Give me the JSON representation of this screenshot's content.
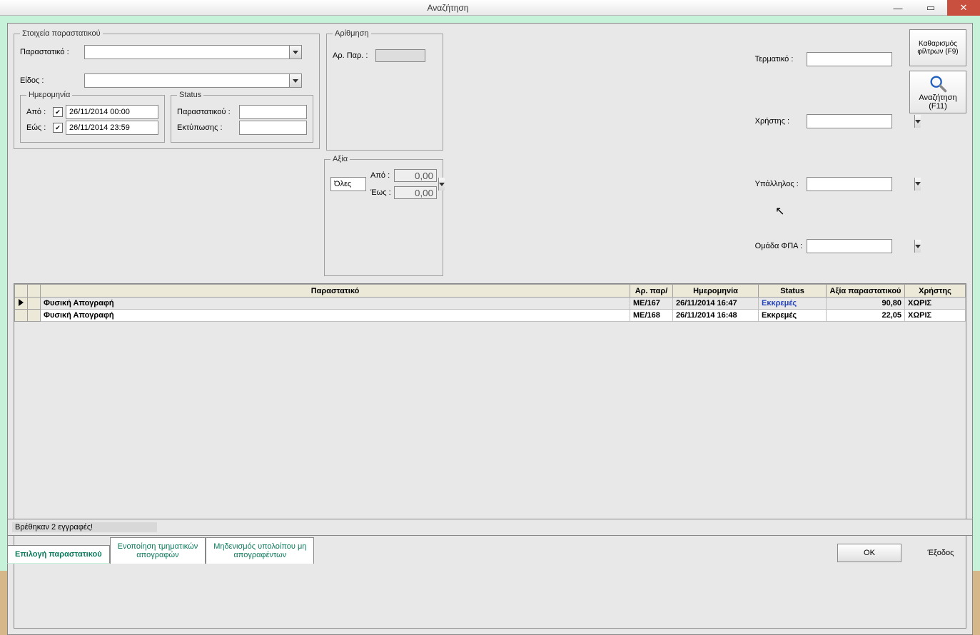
{
  "window": {
    "title": "Αναζήτηση"
  },
  "doc_group": {
    "legend": "Στοιχεία παραστατικού",
    "parastatiko_label": "Παραστατικό :",
    "eidos_label": "Είδος :"
  },
  "num_group": {
    "legend": "Αρίθμηση",
    "ar_par_label": "Αρ. Παρ. :"
  },
  "date_group": {
    "legend": "Ημερομηνία",
    "apo_label": "Από :",
    "eos_label": "Εώς :",
    "apo_val": "26/11/2014 00:00",
    "eos_val": "26/11/2014 23:59"
  },
  "status_group": {
    "legend": "Status",
    "par_label": "Παραστατικού :",
    "ekt_label": "Εκτύπωσης :"
  },
  "value_group": {
    "legend": "Αξία",
    "all_label": "Όλες",
    "apo_label": "Από :",
    "eos_label": "Έως :",
    "apo_val": "0,00",
    "eos_val": "0,00"
  },
  "right": {
    "term_label": "Τερματικό :",
    "user_label": "Χρήστης :",
    "emp_label": "Υπάλληλος :",
    "vat_label": "Ομάδα ΦΠΑ :"
  },
  "buttons": {
    "clear_l1": "Καθαρισμός",
    "clear_l2": "φίλτρων (F9)",
    "search_l1": "Αναζήτηση",
    "search_l2": "(F11)"
  },
  "table": {
    "headers": {
      "doc": "Παραστατικό",
      "num": "Αρ. παρ/",
      "date": "Ημερομηνία",
      "status": "Status",
      "value": "Αξία παραστατικού",
      "user": "Χρήστης"
    },
    "rows": [
      {
        "doc": "Φυσική Απογραφή",
        "num": "ΜΕ/167",
        "date": "26/11/2014 16:47",
        "status": "Εκκρεμές",
        "value": "90,80",
        "user": "ΧΩΡΙΣ"
      },
      {
        "doc": "Φυσική Απογραφή",
        "num": "ΜΕ/168",
        "date": "26/11/2014 16:48",
        "status": "Εκκρεμές",
        "value": "22,05",
        "user": "ΧΩΡΙΣ"
      }
    ]
  },
  "footer": {
    "status_msg": "Βρέθηκαν 2 εγγραφές!",
    "tab1": "Επιλογή παραστατικού",
    "tab2_l1": "Ενοποίηση τμηματικών",
    "tab2_l2": "απογραφών",
    "tab3_l1": "Μηδενισμός υπολοίπου μη",
    "tab3_l2": "απογραφέντων",
    "ok": "OK",
    "exit": "Έξοδος"
  }
}
